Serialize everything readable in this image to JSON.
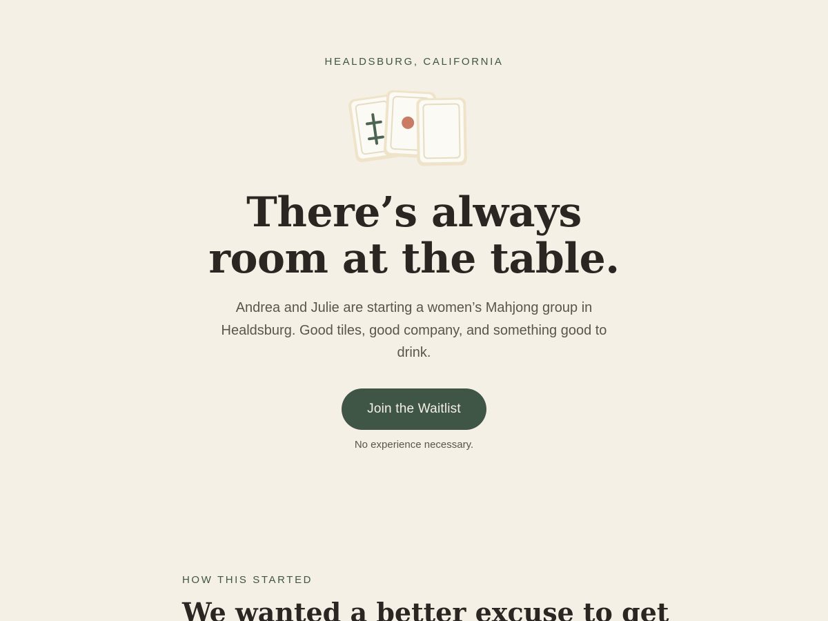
{
  "hero": {
    "location": "HEALDSBURG, CALIFORNIA",
    "title_line_1": "There’s always",
    "title_line_2": "room at the table.",
    "description": "Andrea and Julie are starting a women’s Mahjong group in Healdsburg. Good tiles, good company, and something good to drink.",
    "cta_label": "Join the Waitlist",
    "cta_note": "No experience necessary.",
    "tile_icons": [
      "bamboo-tile-icon",
      "dot-tile-icon",
      "blank-tile-icon"
    ]
  },
  "story": {
    "eyebrow": "HOW THIS STARTED",
    "title": "We wanted a better excuse to get"
  },
  "colors": {
    "background": "#f5f0e6",
    "accent": "#3f5646",
    "text": "#2b2621",
    "muted_text": "#5a544c",
    "tile_face": "#fbfaf4",
    "tile_edge": "#efe4c9",
    "dot": "#c97b63"
  }
}
